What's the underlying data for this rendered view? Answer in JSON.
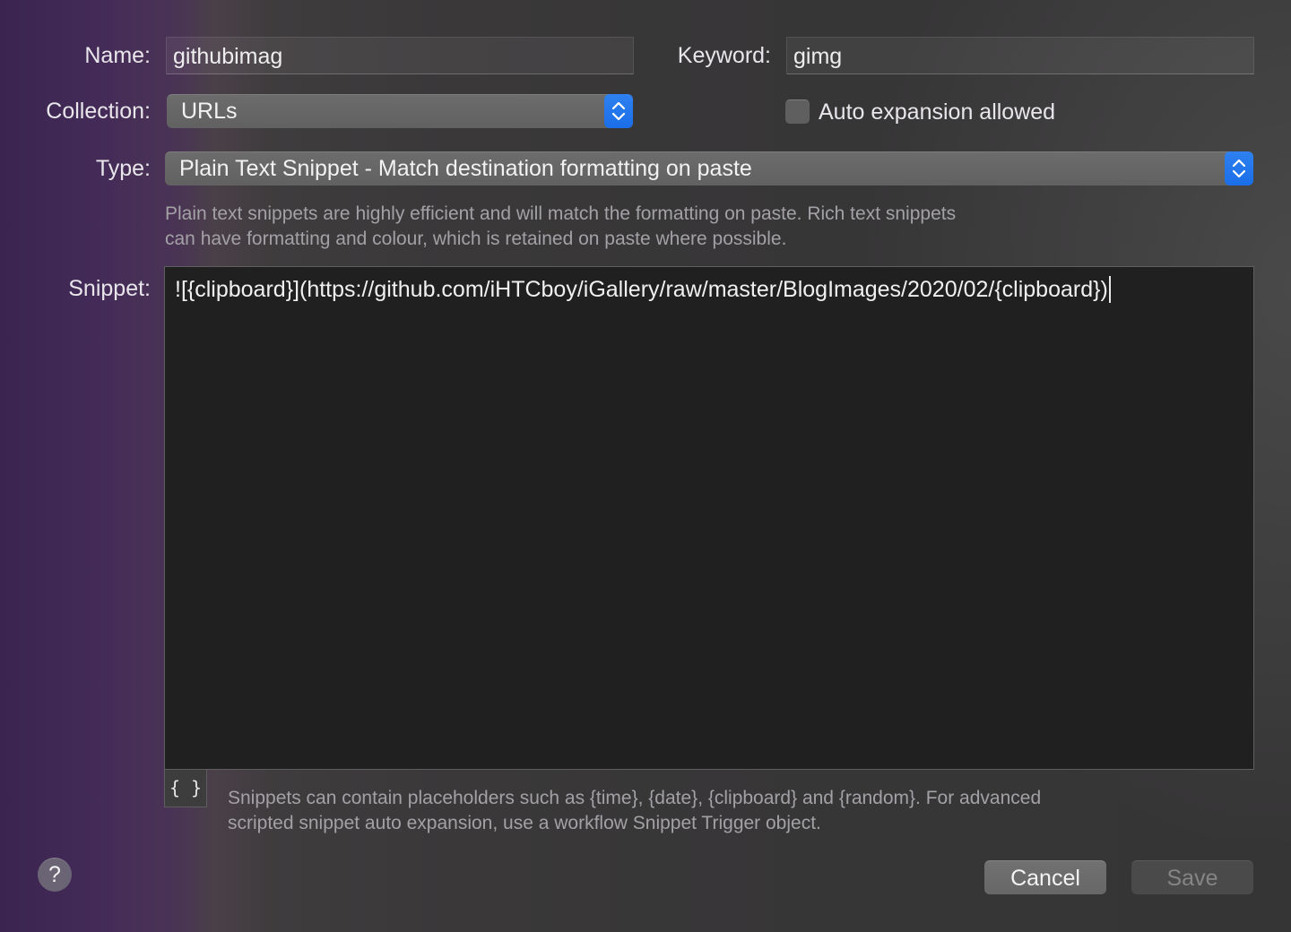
{
  "form": {
    "name_label": "Name:",
    "name_value": "githubimag",
    "keyword_label": "Keyword:",
    "keyword_value": "gimg",
    "collection_label": "Collection:",
    "collection_value": "URLs",
    "auto_expansion_label": "Auto expansion allowed",
    "auto_expansion_checked": false,
    "type_label": "Type:",
    "type_value": "Plain Text Snippet - Match destination formatting on paste",
    "type_help_line1": "Plain text snippets are highly efficient and will match the formatting on paste. Rich text snippets",
    "type_help_line2": "can have formatting and colour, which is retained on paste where possible.",
    "snippet_label": "Snippet:",
    "snippet_value": "![{clipboard}](https://github.com/iHTCboy/iGallery/raw/master/BlogImages/2020/02/{clipboard})",
    "placeholders_button": "{ }",
    "snippet_help_line1": "Snippets can contain placeholders such as {time}, {date}, {clipboard} and {random}. For advanced",
    "snippet_help_line2": "scripted snippet auto expansion, use a workflow Snippet Trigger object."
  },
  "footer": {
    "help_button": "?",
    "cancel_label": "Cancel",
    "save_label": "Save",
    "save_enabled": false
  },
  "colors": {
    "accent": "#1a6ee8",
    "snippet_background": "#202020"
  },
  "icons": {
    "stepper": "chevron-up-down-icon",
    "help": "question-mark-icon"
  }
}
